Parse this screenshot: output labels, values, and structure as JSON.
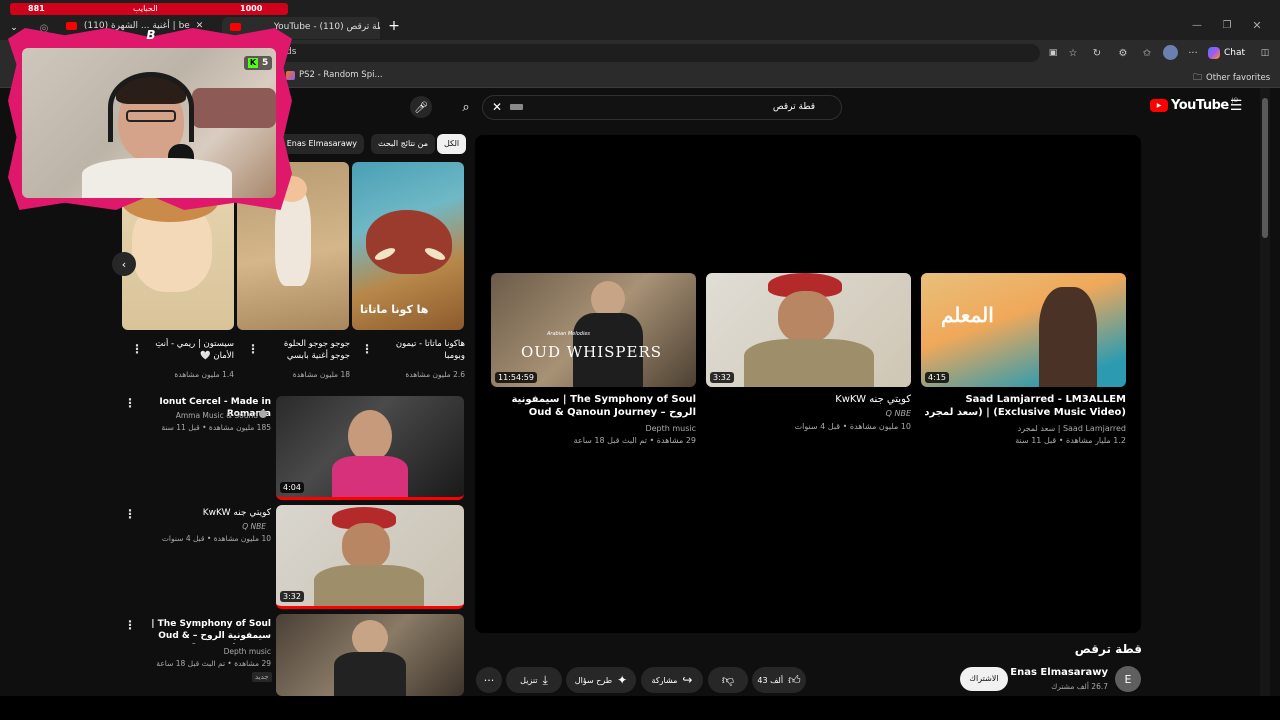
{
  "browser": {
    "tabs": [
      {
        "label": "(110) أغنية ... الشهرة | be"
      },
      {
        "label": "YouTube - (110) قطة ترقص"
      }
    ],
    "address_fragment": "ds",
    "bookmarks": [
      {
        "label": "PS2 - Random Spi..."
      }
    ],
    "other_favorites": "Other favorites",
    "chat_label": "Chat"
  },
  "overlay": {
    "left_count": "881",
    "center_label": "الحبايب",
    "right_count": "1000",
    "badge_count": "5",
    "logo_letter": "B"
  },
  "youtube": {
    "logo": "YouTube",
    "region": "JO",
    "search_query": "قطة ترقص"
  },
  "chips": [
    {
      "label": "الكل"
    },
    {
      "label": "من نتائج البحث"
    },
    {
      "label": "من Enas Elmasarawy"
    }
  ],
  "shorts": [
    {
      "title": "هاكونا ماتاتا - تيمون وبومبا",
      "views": "2.6 مليون مشاهدة",
      "caption": "ها كونا ماتاتا"
    },
    {
      "title": "جوجو جوجو الحلوة جوجو أغنية بابسي جوجو...",
      "views": "18 مليون مشاهدة"
    },
    {
      "title": "سيستون | ريمي - أنتِ الأمان 🤍",
      "views": "1.4 مليون مشاهدة"
    }
  ],
  "list": [
    {
      "title": "Ionut Cercel - Made in Romania",
      "channel": "Amma Music & Sound",
      "meta": "185 مليون مشاهدة • قبل 11 سنة",
      "duration": "4:04"
    },
    {
      "title": "كويتي جنه KwKW",
      "channel": "Q NBE",
      "meta": "10 مليون مشاهدة • قبل 4 سنوات",
      "duration": "3:32"
    },
    {
      "title": "The Symphony of Soul | سيمفونية الروح – Oud & Qanoun Journey",
      "channel": "Depth music",
      "meta": "29 مشاهدة • تم البث قبل 18 ساعة",
      "badge": "جديد"
    }
  ],
  "endscreen": [
    {
      "title": "Saad Lamjarred - LM3ALLEM (Exclusive Music Video) | (سعد لمجرد - لمعلم (فيديو كليب...",
      "channel": "Saad Lamjarred | سعد لمجرد",
      "meta": "1.2 مليار مشاهدة • قبل 11 سنة",
      "duration": "4:15",
      "thumb_text": "المعلم"
    },
    {
      "title": "كويتي جنه KwKW",
      "channel": "Q NBE",
      "meta": "10 مليون مشاهدة • قبل 4 سنوات",
      "duration": "3:32"
    },
    {
      "title": "The Symphony of Soul | سيمفونية الروح – Oud & Qanoun Journey (Meditation, Relaxing",
      "channel": "Depth music",
      "meta": "29 مشاهدة • تم البث قبل 18 ساعة",
      "duration": "11:54:59",
      "thumb_text": "OUD WHISPERS",
      "thumb_sub": "Arabian Melodies"
    }
  ],
  "video": {
    "title": "قطة ترقص",
    "channel": "Enas Elmasarawy",
    "subscribers": "26.7 ألف مشترك",
    "avatar_letter": "E",
    "subscribe": "الاشتراك",
    "likes": "43 ألف",
    "share": "مشاركة",
    "ask": "طرح سؤال",
    "download": "تنزيل"
  },
  "colors": {
    "bg": "#0f0f0f",
    "red": "#ff0000",
    "chip": "#272727",
    "overlay_pink": "#e0186c"
  }
}
